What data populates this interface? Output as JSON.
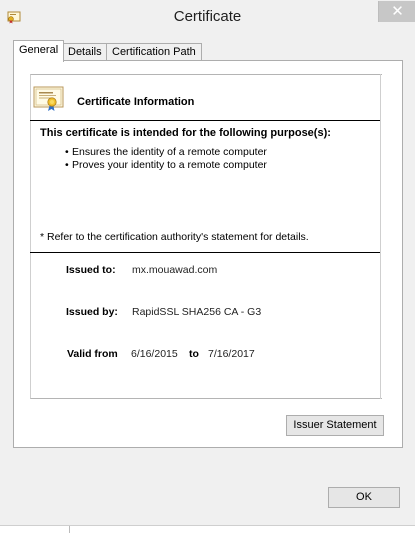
{
  "window": {
    "title": "Certificate",
    "close_symbol": "✕"
  },
  "tabs": [
    {
      "label": "General",
      "active": true
    },
    {
      "label": "Details",
      "active": false
    },
    {
      "label": "Certification Path",
      "active": false
    }
  ],
  "general": {
    "info_title": "Certificate Information",
    "purpose_heading": "This certificate is intended for the following purpose(s):",
    "purposes": [
      "Ensures the identity of a remote computer",
      "Proves your identity to a remote computer"
    ],
    "note": "* Refer to the certification authority's statement for details.",
    "issued_to_label": "Issued to:",
    "issued_to_value": "mx.mouawad.com",
    "issued_by_label": "Issued by:",
    "issued_by_value": "RapidSSL SHA256 CA - G3",
    "valid_from_label": "Valid from",
    "valid_from_value": "6/16/2015",
    "valid_to_label": "to",
    "valid_to_value": "7/16/2017"
  },
  "buttons": {
    "issuer_statement": "Issuer Statement",
    "ok": "OK"
  },
  "icons": {
    "title_icon": "certificate-icon",
    "info_icon": "certificate-icon"
  }
}
